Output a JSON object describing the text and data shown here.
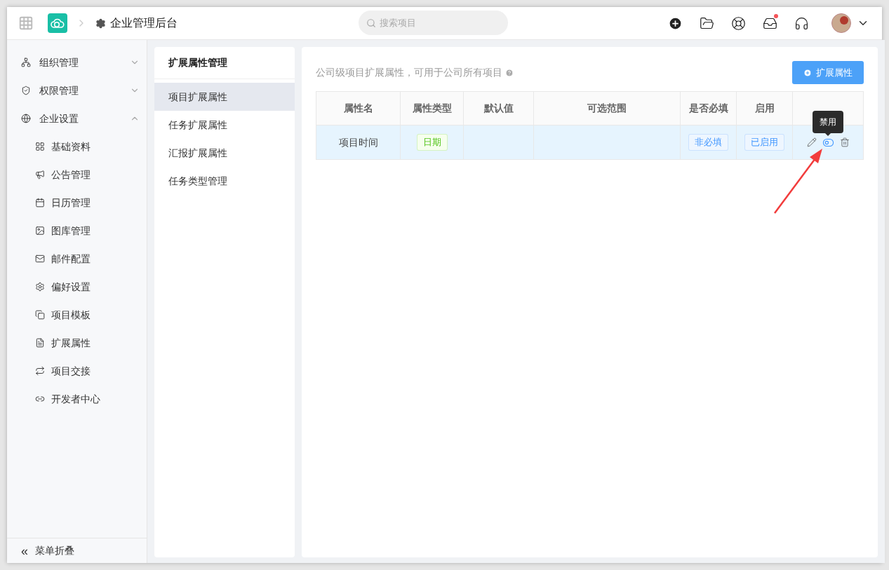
{
  "header": {
    "title": "企业管理后台",
    "search": {
      "placeholder": "搜索项目"
    },
    "notification_dot": true
  },
  "sidebar": {
    "items": [
      {
        "label": "组织管理",
        "expanded": false
      },
      {
        "label": "权限管理",
        "expanded": false
      },
      {
        "label": "企业设置",
        "expanded": true,
        "children": [
          {
            "label": "基础资料"
          },
          {
            "label": "公告管理"
          },
          {
            "label": "日历管理"
          },
          {
            "label": "图库管理"
          },
          {
            "label": "邮件配置"
          },
          {
            "label": "偏好设置"
          },
          {
            "label": "项目模板"
          },
          {
            "label": "扩展属性"
          },
          {
            "label": "项目交接"
          },
          {
            "label": "开发者中心"
          }
        ]
      }
    ],
    "collapse": {
      "icon": "«",
      "label": "菜单折叠"
    }
  },
  "submenu": {
    "title": "扩展属性管理",
    "items": [
      {
        "label": "项目扩展属性",
        "selected": true
      },
      {
        "label": "任务扩展属性",
        "selected": false
      },
      {
        "label": "汇报扩展属性",
        "selected": false
      },
      {
        "label": "任务类型管理",
        "selected": false
      }
    ]
  },
  "content": {
    "description": "公司级项目扩展属性，可用于公司所有项目",
    "add_button": "扩展属性",
    "table": {
      "columns": [
        "属性名",
        "属性类型",
        "默认值",
        "可选范围",
        "是否必填",
        "启用"
      ],
      "rows": [
        {
          "name": "项目时间",
          "type": {
            "label": "日期",
            "color": "#52c41a"
          },
          "required": {
            "label": "非必填",
            "color": "#4096ff"
          },
          "enabled": {
            "label": "已启用",
            "color": "#4096ff"
          },
          "tooltip": "禁用"
        }
      ]
    }
  }
}
